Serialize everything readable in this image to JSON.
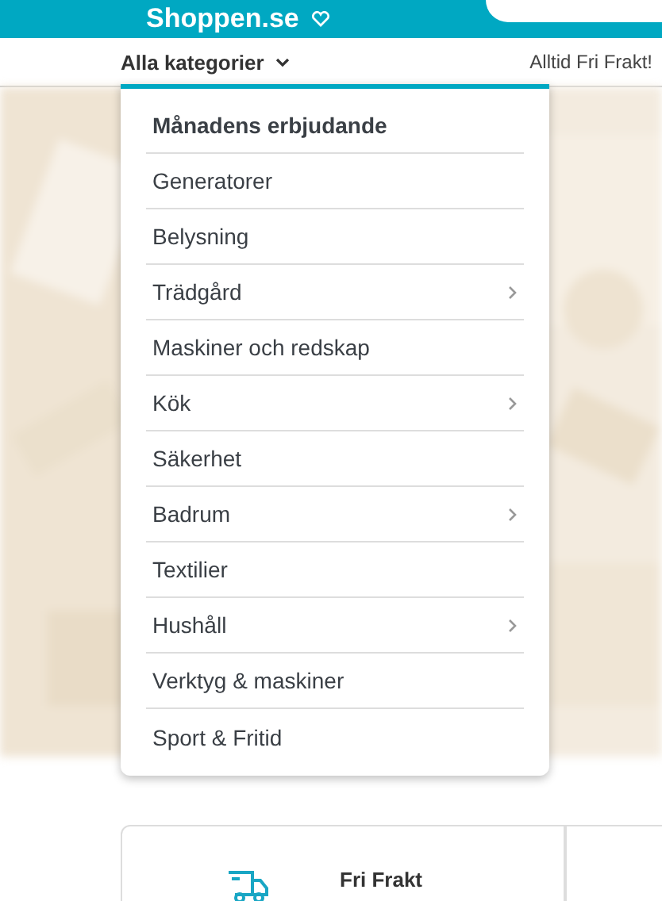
{
  "header": {
    "logo": "Shoppen.se"
  },
  "nav": {
    "categories_button": "Alla kategorier",
    "expanded": true,
    "promo": "Alltid Fri Frakt!"
  },
  "menu": {
    "items": [
      {
        "label": "Månadens erbjudande",
        "featured": true,
        "has_submenu": false
      },
      {
        "label": "Generatorer",
        "featured": false,
        "has_submenu": false
      },
      {
        "label": "Belysning",
        "featured": false,
        "has_submenu": false
      },
      {
        "label": "Trädgård",
        "featured": false,
        "has_submenu": true
      },
      {
        "label": "Maskiner och redskap",
        "featured": false,
        "has_submenu": false
      },
      {
        "label": "Kök",
        "featured": false,
        "has_submenu": true
      },
      {
        "label": "Säkerhet",
        "featured": false,
        "has_submenu": false
      },
      {
        "label": "Badrum",
        "featured": false,
        "has_submenu": true
      },
      {
        "label": "Textilier",
        "featured": false,
        "has_submenu": false
      },
      {
        "label": "Hushåll",
        "featured": false,
        "has_submenu": true
      },
      {
        "label": "Verktyg & maskiner",
        "featured": false,
        "has_submenu": false
      },
      {
        "label": "Sport & Fritid",
        "featured": false,
        "has_submenu": false
      }
    ]
  },
  "features": [
    {
      "title": "Fri Frakt"
    }
  ]
}
